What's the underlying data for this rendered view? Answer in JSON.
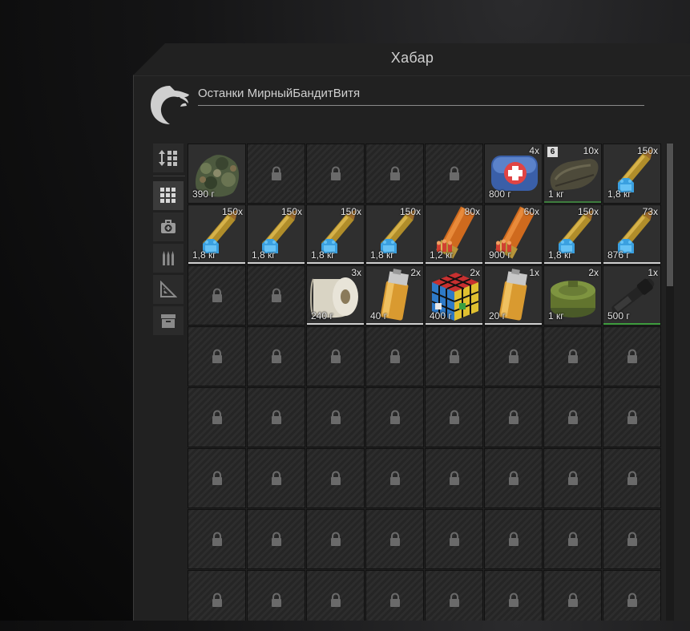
{
  "window": {
    "title": "Хабар"
  },
  "owner": {
    "name": "Останки МирныйБандитВитя",
    "icon": "eagle-icon"
  },
  "sidebar": [
    {
      "name": "sort-button",
      "icon": "sort-icon",
      "active": false
    },
    {
      "name": "filter-all",
      "icon": "grid-icon",
      "active": true
    },
    {
      "name": "filter-medical",
      "icon": "medkit-icon",
      "active": false
    },
    {
      "name": "filter-ammo",
      "icon": "bullets-icon",
      "active": false
    },
    {
      "name": "filter-misc",
      "icon": "ruler-triangle-icon",
      "active": false
    },
    {
      "name": "filter-containers",
      "icon": "box-icon",
      "active": false
    }
  ],
  "grid": {
    "columns": 8,
    "total_rows": 8,
    "items": [
      {
        "row": 0,
        "col": 0,
        "icon": "ghillie-cloth",
        "count": "",
        "weight": "390 г",
        "line": ""
      },
      {
        "row": 0,
        "col": 5,
        "icon": "medkit",
        "count": "4x",
        "weight": "800 г",
        "line": ""
      },
      {
        "row": 0,
        "col": 6,
        "icon": "bag",
        "count": "10x",
        "weight": "1 кг",
        "badge": "6",
        "line": "#3f7d3f"
      },
      {
        "row": 0,
        "col": 7,
        "icon": "bullet-blue",
        "count": "150x",
        "weight": "1,8 кг",
        "line": ""
      },
      {
        "row": 1,
        "col": 0,
        "icon": "bullet-blue",
        "count": "150x",
        "weight": "1,8 кг",
        "line": "#d0d0d0"
      },
      {
        "row": 1,
        "col": 1,
        "icon": "bullet-blue",
        "count": "150x",
        "weight": "1,8 кг",
        "line": "#d0d0d0"
      },
      {
        "row": 1,
        "col": 2,
        "icon": "bullet-blue",
        "count": "150x",
        "weight": "1,8 кг",
        "line": "#d0d0d0"
      },
      {
        "row": 1,
        "col": 3,
        "icon": "bullet-blue",
        "count": "150x",
        "weight": "1,8 кг",
        "line": "#d0d0d0"
      },
      {
        "row": 1,
        "col": 4,
        "icon": "shell-orange",
        "count": "80x",
        "weight": "1,2 кг",
        "line": "#d0d0d0"
      },
      {
        "row": 1,
        "col": 5,
        "icon": "shell-orange",
        "count": "60x",
        "weight": "900 г",
        "line": "#d0d0d0"
      },
      {
        "row": 1,
        "col": 6,
        "icon": "bullet-blue",
        "count": "150x",
        "weight": "1,8 кг",
        "line": "#d0d0d0"
      },
      {
        "row": 1,
        "col": 7,
        "icon": "bullet-blue",
        "count": "73x",
        "weight": "876 г",
        "line": "#d0d0d0"
      },
      {
        "row": 2,
        "col": 2,
        "icon": "paper-roll",
        "count": "3x",
        "weight": "240 г",
        "line": "#d0d0d0"
      },
      {
        "row": 2,
        "col": 3,
        "icon": "lighter",
        "count": "2x",
        "weight": "40 г",
        "line": "#d0d0d0"
      },
      {
        "row": 2,
        "col": 4,
        "icon": "rubik-cube",
        "count": "2x",
        "weight": "400 г",
        "line": "#d0d0d0"
      },
      {
        "row": 2,
        "col": 5,
        "icon": "lighter",
        "count": "1x",
        "weight": "20 г",
        "line": "#d0d0d0"
      },
      {
        "row": 2,
        "col": 6,
        "icon": "green-can",
        "count": "2x",
        "weight": "1 кг",
        "line": ""
      },
      {
        "row": 2,
        "col": 7,
        "icon": "black-tool",
        "count": "1x",
        "weight": "500 г",
        "line": "#3f9d3f"
      }
    ]
  }
}
